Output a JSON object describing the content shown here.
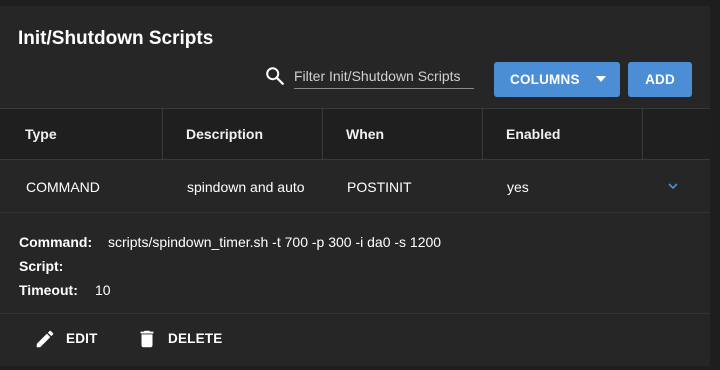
{
  "title": "Init/Shutdown Scripts",
  "filter": {
    "placeholder": "Filter Init/Shutdown Scripts",
    "value": ""
  },
  "buttons": {
    "columns": "COLUMNS",
    "add": "ADD"
  },
  "table": {
    "headers": [
      "Type",
      "Description",
      "When",
      "Enabled"
    ],
    "rows": [
      {
        "type": "COMMAND",
        "description": "spindown and auto",
        "when": "POSTINIT",
        "enabled": "yes"
      }
    ]
  },
  "detail": {
    "command_label": "Command:",
    "command_value": "scripts/spindown_timer.sh -t 700 -p 300 -i da0 -s 1200",
    "script_label": "Script:",
    "script_value": "",
    "timeout_label": "Timeout:",
    "timeout_value": "10"
  },
  "actions": {
    "edit": "EDIT",
    "delete": "DELETE"
  },
  "colors": {
    "accent": "#4b8ed6",
    "background": "#262626",
    "header": "#1f1f1f"
  }
}
